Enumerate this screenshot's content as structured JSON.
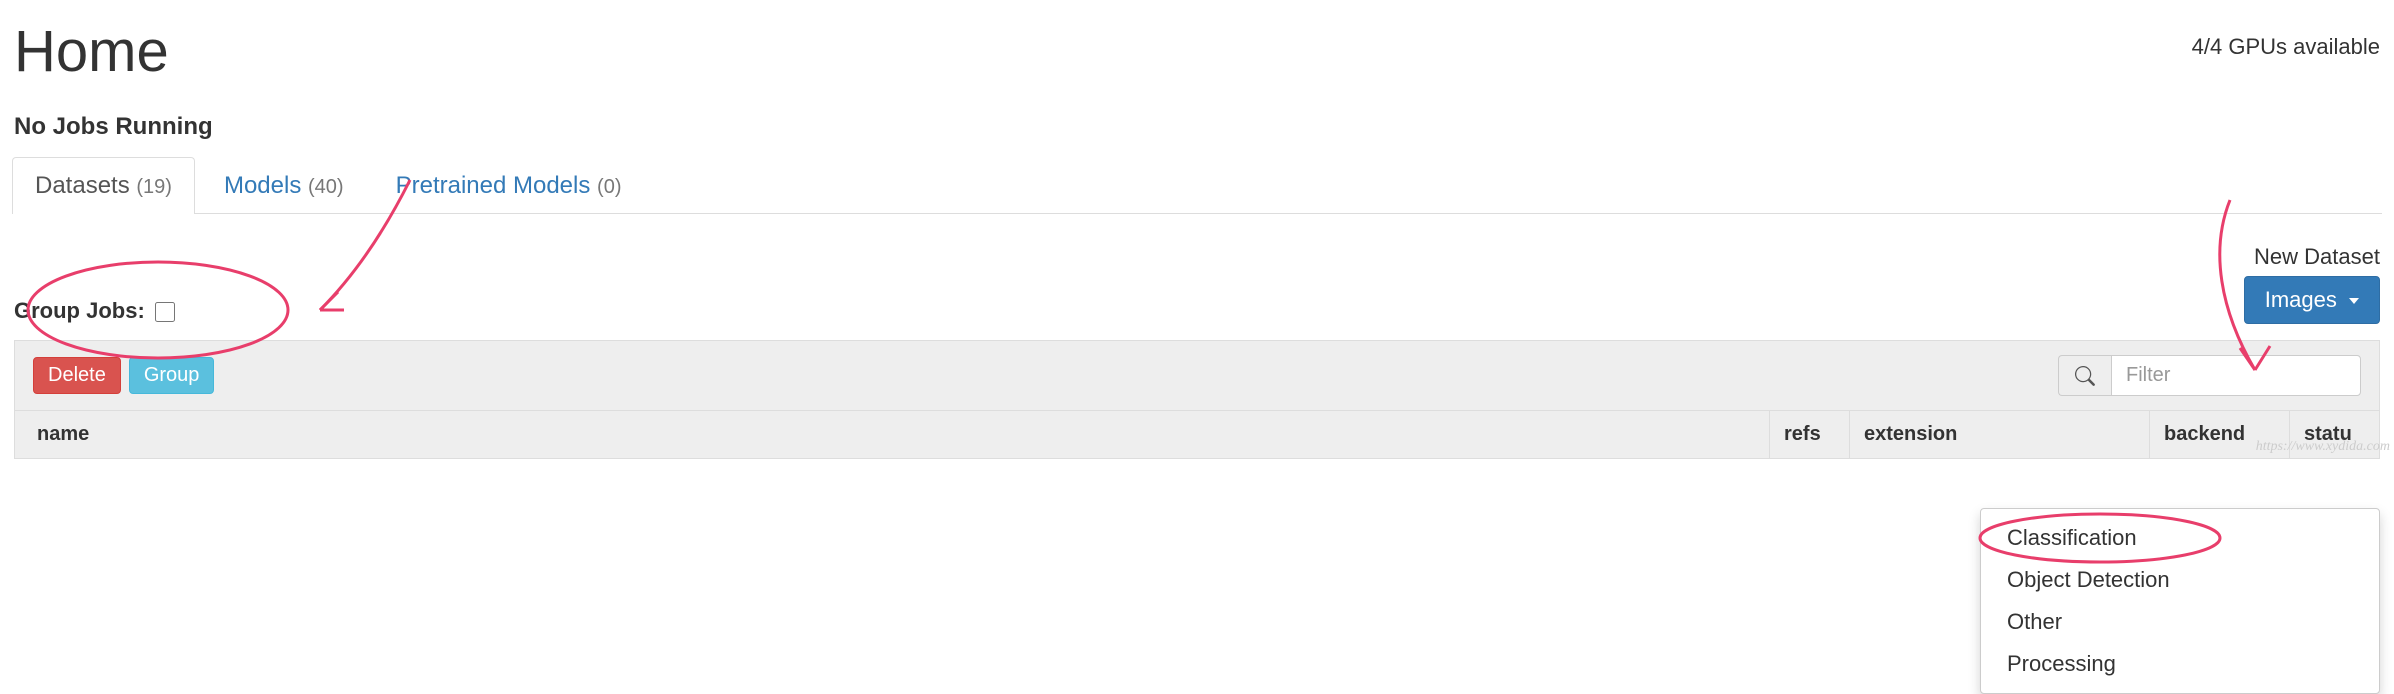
{
  "header": {
    "title": "Home",
    "gpu_status": "4/4 GPUs available"
  },
  "jobs": {
    "heading": "No Jobs Running"
  },
  "tabs": {
    "datasets": {
      "label": "Datasets",
      "count": "(19)"
    },
    "models": {
      "label": "Models",
      "count": "(40)"
    },
    "pretrained": {
      "label": "Pretrained Models",
      "count": "(0)"
    }
  },
  "controls": {
    "group_jobs_label": "Group Jobs:",
    "new_dataset_label": "New Dataset",
    "images_button": "Images",
    "delete_button": "Delete",
    "group_button": "Group",
    "filter_placeholder": "Filter"
  },
  "dropdown": {
    "items": [
      "Classification",
      "Object Detection",
      "Other",
      "Processing"
    ]
  },
  "table": {
    "columns": {
      "name": "name",
      "refs": "refs",
      "extension": "extension",
      "backend": "backend",
      "status": "statu"
    }
  },
  "watermark": "https://www.xydida.com"
}
